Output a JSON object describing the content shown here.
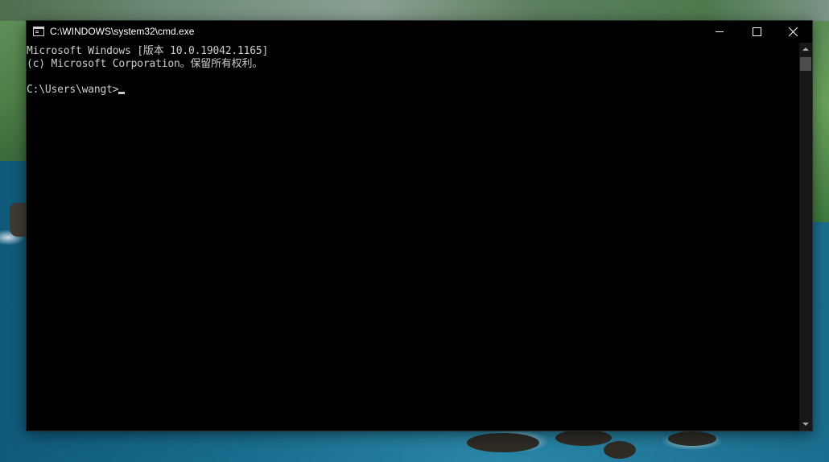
{
  "window": {
    "title": "C:\\WINDOWS\\system32\\cmd.exe",
    "icon": "cmd-icon",
    "controls": {
      "minimize": "minimize-icon",
      "maximize": "maximize-icon",
      "close": "close-icon"
    }
  },
  "console": {
    "lines": [
      "Microsoft Windows [版本 10.0.19042.1165]",
      "(c) Microsoft Corporation。保留所有权利。",
      "",
      "C:\\Users\\wangt>"
    ],
    "prompt": "C:\\Users\\wangt>",
    "input": "",
    "text_color": "#cccccc",
    "background_color": "#000000"
  },
  "scrollbar": {
    "up_icon": "chevron-up-icon",
    "down_icon": "chevron-down-icon"
  }
}
